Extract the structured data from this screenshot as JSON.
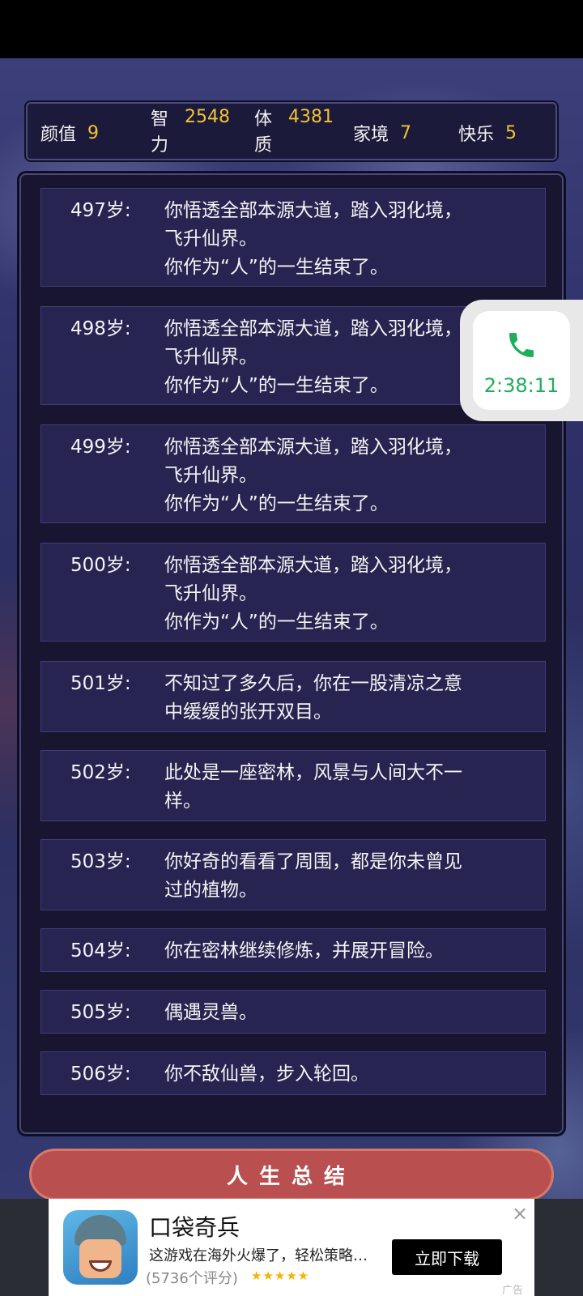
{
  "stats": {
    "appearance": {
      "label": "颜值",
      "value": "9"
    },
    "intelligence": {
      "label": "智力",
      "value": "2548"
    },
    "constitution": {
      "label": "体质",
      "value": "4381"
    },
    "family": {
      "label": "家境",
      "value": "7"
    },
    "happiness": {
      "label": "快乐",
      "value": "5"
    }
  },
  "entries": [
    {
      "age": "497岁:",
      "text": "你悟透全部本源大道，踏入羽化境，\n飞升仙界。\n你作为“人”的一生结束了。"
    },
    {
      "age": "498岁:",
      "text": "你悟透全部本源大道，踏入羽化境，\n飞升仙界。\n你作为“人”的一生结束了。"
    },
    {
      "age": "499岁:",
      "text": "你悟透全部本源大道，踏入羽化境，\n飞升仙界。\n你作为“人”的一生结束了。"
    },
    {
      "age": "500岁:",
      "text": "你悟透全部本源大道，踏入羽化境，\n飞升仙界。\n你作为“人”的一生结束了。"
    },
    {
      "age": "501岁:",
      "text": "不知过了多久后，你在一股清凉之意\n中缓缓的张开双目。"
    },
    {
      "age": "502岁:",
      "text": "此处是一座密林，风景与人间大不一\n样。"
    },
    {
      "age": "503岁:",
      "text": "你好奇的看看了周围，都是你未曾见\n过的植物。"
    },
    {
      "age": "504岁:",
      "text": "你在密林继续修炼，并展开冒险。"
    },
    {
      "age": "505岁:",
      "text": "偶遇灵兽。"
    },
    {
      "age": "506岁:",
      "text": "你不敌仙兽，步入轮回。"
    }
  ],
  "call": {
    "timer": "2:38:11",
    "icon": "phone-icon",
    "color": "#1fae5b"
  },
  "summary_button": "人生总结",
  "ad": {
    "title": "口袋奇兵",
    "description": "这游戏在海外火爆了，轻松策略…",
    "rating_text": "(5736个评分)",
    "stars": "★★★★★",
    "download_label": "立即下载",
    "close": "×",
    "tag": "广告"
  }
}
